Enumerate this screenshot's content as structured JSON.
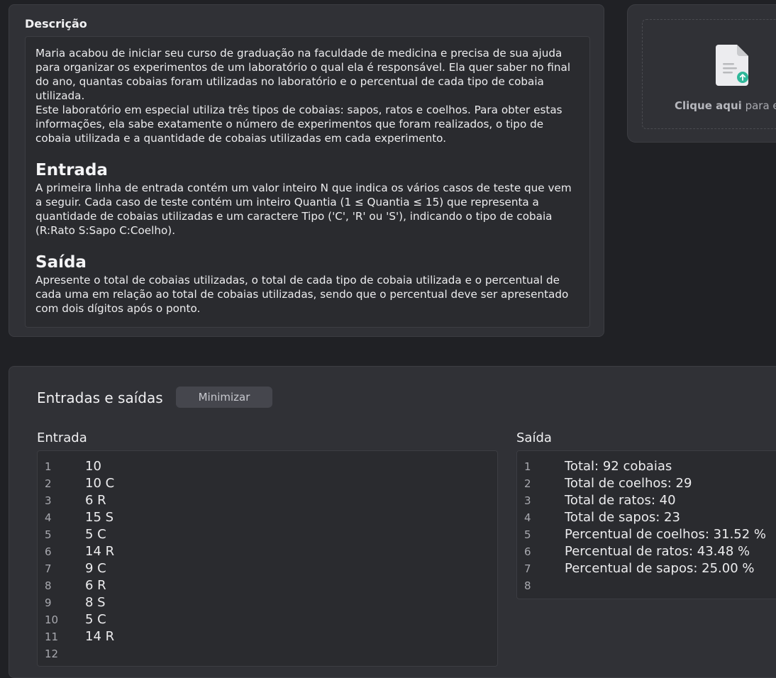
{
  "description": {
    "title": "Descrição",
    "intro1": "Maria acabou de iniciar seu curso de graduação na faculdade de medicina e precisa de sua ajuda para organizar os experimentos de um laboratório o qual ela é responsável. Ela quer saber no final do ano, quantas cobaias foram utilizadas no laboratório e o percentual de cada tipo de cobaia utilizada.",
    "intro2": "Este laboratório em especial utiliza três tipos de cobaias: sapos, ratos e coelhos. Para obter estas informações, ela sabe exatamente o número de experimentos que foram realizados, o tipo de cobaia utilizada e a quantidade de cobaias utilizadas em cada experimento.",
    "input_heading": "Entrada",
    "input_text": "A primeira linha de entrada contém um valor inteiro N que indica os vários casos de teste que vem a seguir. Cada caso de teste contém um inteiro Quantia (1 ≤ Quantia ≤ 15) que representa a quantidade de cobaias utilizadas e um caractere Tipo ('C', 'R' ou 'S'), indicando o tipo de cobaia (R:Rato S:Sapo C:Coelho).",
    "output_heading": "Saída",
    "output_text": "Apresente o total de cobaias utilizadas, o total de cada tipo de cobaia utilizada e o percentual de cada uma em relação ao total de cobaias utilizadas, sendo que o percentual deve ser apresentado com dois dígitos após o ponto."
  },
  "upload": {
    "text_bold": "Clique aqui",
    "text_rest": " para en",
    "icon": "file-upload-icon"
  },
  "io": {
    "title": "Entradas e saídas",
    "minimize_label": "Minimizar",
    "input_label": "Entrada",
    "output_label": "Saída",
    "input_lines": [
      {
        "n": "1",
        "t": "10"
      },
      {
        "n": "2",
        "t": "10 C"
      },
      {
        "n": "3",
        "t": "6 R"
      },
      {
        "n": "4",
        "t": "15 S"
      },
      {
        "n": "5",
        "t": "5 C"
      },
      {
        "n": "6",
        "t": "14 R"
      },
      {
        "n": "7",
        "t": "9 C"
      },
      {
        "n": "8",
        "t": "6 R"
      },
      {
        "n": "9",
        "t": "8 S"
      },
      {
        "n": "10",
        "t": "5 C"
      },
      {
        "n": "11",
        "t": "14 R"
      },
      {
        "n": "12",
        "t": ""
      }
    ],
    "output_lines": [
      {
        "n": "1",
        "t": "Total: 92 cobaias"
      },
      {
        "n": "2",
        "t": "Total de coelhos: 29"
      },
      {
        "n": "3",
        "t": "Total de ratos: 40"
      },
      {
        "n": "4",
        "t": "Total de sapos: 23"
      },
      {
        "n": "5",
        "t": "Percentual de coelhos: 31.52 %"
      },
      {
        "n": "6",
        "t": "Percentual de ratos: 43.48 %"
      },
      {
        "n": "7",
        "t": "Percentual de sapos: 25.00 %"
      },
      {
        "n": "8",
        "t": ""
      }
    ]
  }
}
